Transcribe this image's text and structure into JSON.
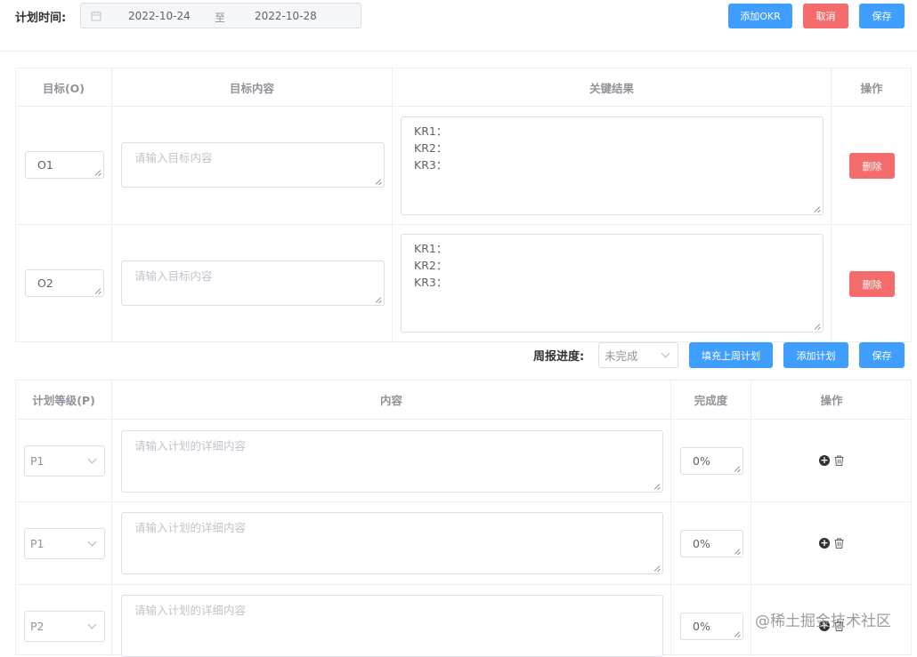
{
  "header": {
    "plan_time_label": "计划时间:",
    "date_start": "2022-10-24",
    "date_sep": "至",
    "date_end": "2022-10-28",
    "add_okr": "添加OKR",
    "cancel": "取消",
    "save": "保存"
  },
  "okr_table": {
    "columns": [
      "目标(O)",
      "目标内容",
      "关键结果",
      "操作"
    ],
    "rows": [
      {
        "objective": "O1",
        "content_placeholder": "请输入目标内容",
        "key_results": "KR1：\nKR2：\nKR3：",
        "delete": "删除"
      },
      {
        "objective": "O2",
        "content_placeholder": "请输入目标内容",
        "key_results": "KR1：\nKR2：\nKR3：",
        "delete": "删除"
      }
    ]
  },
  "weekly": {
    "progress_label": "周报进度:",
    "progress_value": "未完成",
    "fill_last_week": "填充上周计划",
    "add_plan": "添加计划",
    "save": "保存"
  },
  "plan_table": {
    "columns": [
      "计划等级(P)",
      "内容",
      "完成度",
      "操作"
    ],
    "rows": [
      {
        "level": "P1",
        "content_placeholder": "请输入计划的详细内容",
        "completion": "0%"
      },
      {
        "level": "P1",
        "content_placeholder": "请输入计划的详细内容",
        "completion": "0%"
      },
      {
        "level": "P2",
        "content_placeholder": "请输入计划的详细内容",
        "completion": "0%"
      }
    ]
  },
  "icons": {
    "calendar": "calendar-icon",
    "add": "plus-circle-icon",
    "delete": "trash-icon",
    "dropdown": "chevron-down-icon"
  },
  "colors": {
    "primary": "#409eff",
    "danger": "#f56c6c",
    "border": "#ebeef5"
  },
  "watermark": "@稀土掘金技术社区"
}
